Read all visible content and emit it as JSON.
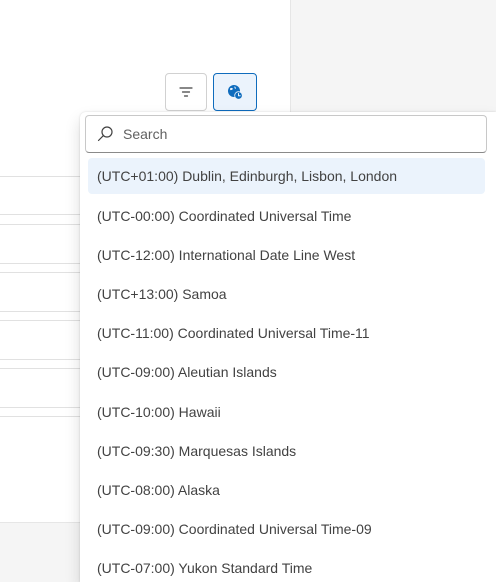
{
  "toolbar": {
    "filter_icon": "filter-icon",
    "timezone_icon": "globe-clock-icon"
  },
  "search": {
    "placeholder": "Search",
    "value": ""
  },
  "timezones": [
    {
      "label": "(UTC+01:00) Dublin, Edinburgh, Lisbon, London",
      "selected": true
    },
    {
      "label": "(UTC-00:00) Coordinated Universal Time"
    },
    {
      "label": "(UTC-12:00) International Date Line West"
    },
    {
      "label": "(UTC+13:00) Samoa"
    },
    {
      "label": "(UTC-11:00) Coordinated Universal Time-11"
    },
    {
      "label": "(UTC-09:00) Aleutian Islands"
    },
    {
      "label": "(UTC-10:00) Hawaii"
    },
    {
      "label": "(UTC-09:30) Marquesas Islands"
    },
    {
      "label": "(UTC-08:00) Alaska"
    },
    {
      "label": "(UTC-09:00) Coordinated Universal Time-09"
    },
    {
      "label": "(UTC-07:00) Yukon Standard Time"
    }
  ],
  "colors": {
    "accent": "#0f6cbd",
    "selected_bg": "#ebf3fc"
  }
}
